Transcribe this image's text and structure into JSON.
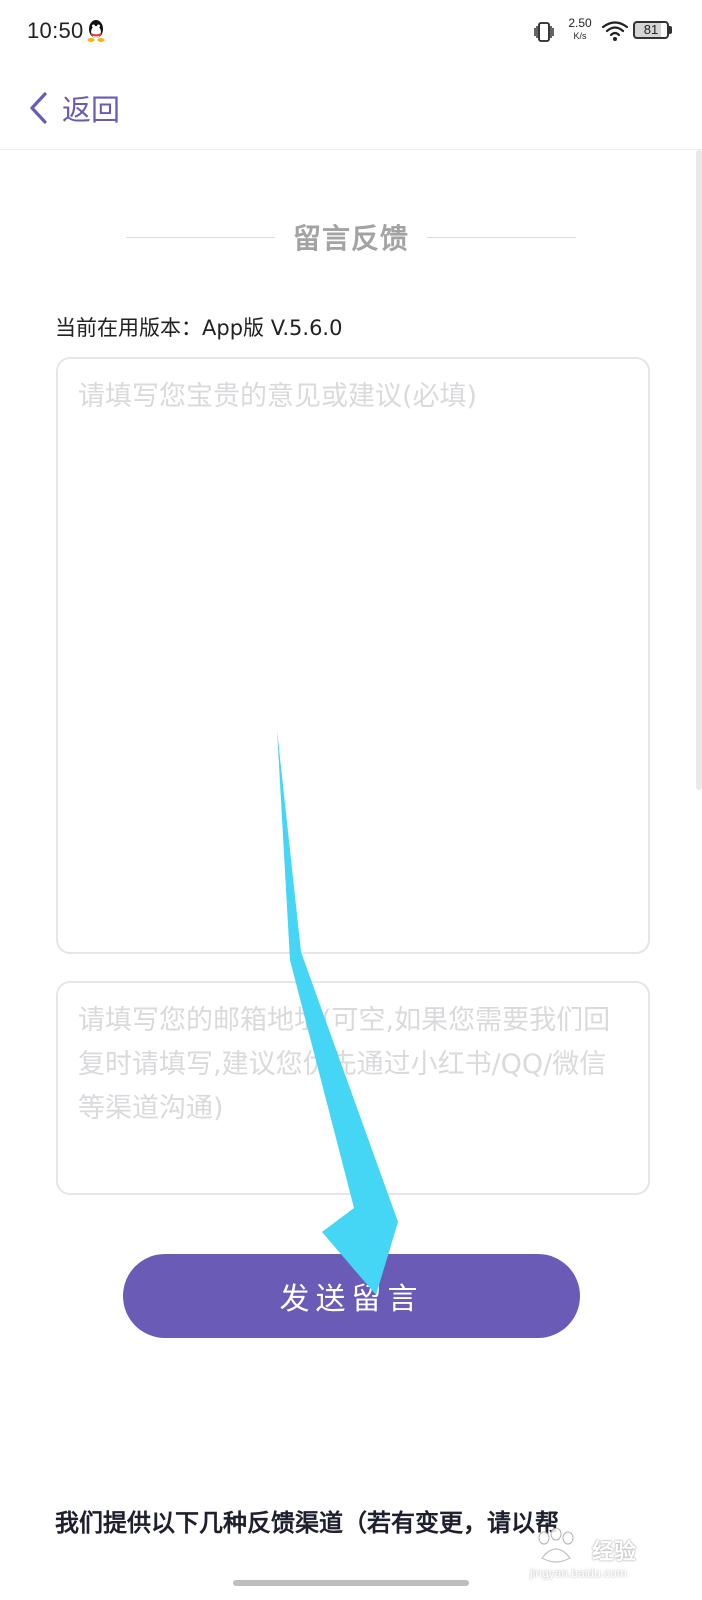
{
  "status_bar": {
    "time": "10:50",
    "net_speed_value": "2.50",
    "net_speed_unit": "K/s",
    "battery_level": "81",
    "icons": [
      "qq-icon",
      "vibrate-icon",
      "wifi-icon",
      "battery-icon"
    ]
  },
  "nav": {
    "back_label": "返回"
  },
  "page": {
    "title": "留言反馈",
    "version_text": "当前在用版本：App版  V.5.6.0"
  },
  "form": {
    "feedback_placeholder": "请填写您宝贵的意见或建议(必填)",
    "feedback_value": "",
    "email_placeholder": "请填写您的邮箱地址(可空,如果您需要我们回复时请填写,建议您优先通过小红书/QQ/微信等渠道沟通)",
    "email_value": "",
    "submit_label": "发送留言"
  },
  "channels": {
    "heading": "我们提供以下几种反馈渠道（若有变更，请以帮"
  },
  "watermark": {
    "text": "经验",
    "url": "jingyan.baidu.com"
  },
  "colors": {
    "accent": "#6a5bb6",
    "annotation_arrow": "#44d6f4",
    "placeholder": "#dadadc"
  }
}
